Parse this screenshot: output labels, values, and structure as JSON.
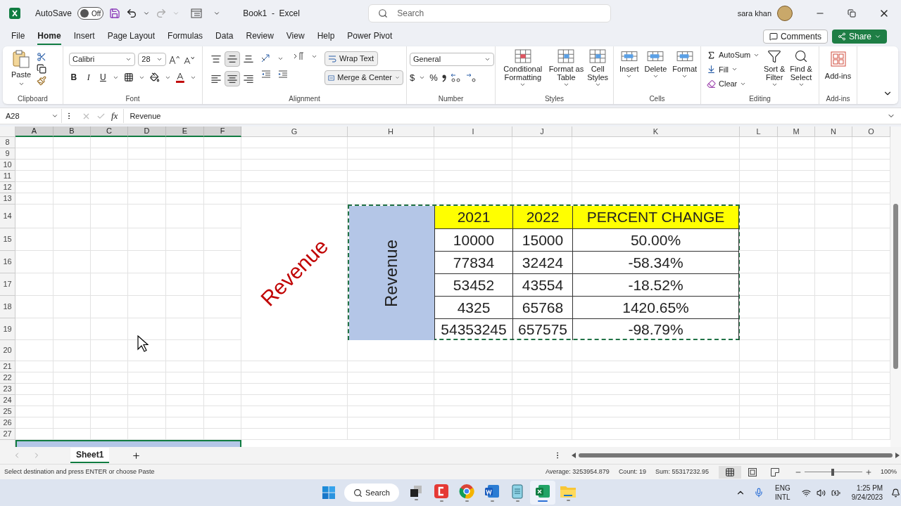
{
  "title_bar": {
    "autosave_label": "AutoSave",
    "autosave_state": "Off",
    "autosave_on": false,
    "document_title": "Book1  -  Excel",
    "search_placeholder": "Search",
    "user_name": "sara khan"
  },
  "ribbon_tabs": [
    {
      "label": "File",
      "selected": false
    },
    {
      "label": "Home",
      "selected": true
    },
    {
      "label": "Insert",
      "selected": false
    },
    {
      "label": "Page Layout",
      "selected": false
    },
    {
      "label": "Formulas",
      "selected": false
    },
    {
      "label": "Data",
      "selected": false
    },
    {
      "label": "Review",
      "selected": false
    },
    {
      "label": "View",
      "selected": false
    },
    {
      "label": "Help",
      "selected": false
    },
    {
      "label": "Power Pivot",
      "selected": false
    }
  ],
  "comments_button": "Comments",
  "share_button": "Share",
  "ribbon": {
    "clipboard": {
      "paste": "Paste",
      "label": "Clipboard"
    },
    "font": {
      "name": "Calibri",
      "size": "28",
      "bold": "B",
      "italic": "I",
      "underline": "U",
      "label": "Font"
    },
    "alignment": {
      "buttons": [
        {
          "kind": "top",
          "selected": false
        },
        {
          "kind": "middle",
          "selected": true
        },
        {
          "kind": "bottom",
          "selected": false
        },
        {
          "kind": "left",
          "selected": false
        },
        {
          "kind": "center",
          "selected": true
        },
        {
          "kind": "right",
          "selected": false
        }
      ],
      "wrap_text": "Wrap Text",
      "merge_center": "Merge & Center",
      "label": "Alignment"
    },
    "number": {
      "format": "General",
      "currency": "$",
      "percent": "%",
      "label": "Number"
    },
    "styles": {
      "items": [
        "Conditional Formatting",
        "Format as Table",
        "Cell Styles"
      ],
      "label": "Styles"
    },
    "cells": {
      "items": [
        "Insert",
        "Delete",
        "Format"
      ],
      "label": "Cells"
    },
    "editing": {
      "autosum": "AutoSum",
      "fill": "Fill",
      "clear": "Clear",
      "sort_filter": "Sort & Filter",
      "find_select": "Find & Select",
      "label": "Editing"
    },
    "addins": {
      "button": "Add-ins",
      "label": "Add-ins"
    }
  },
  "formula_bar": {
    "name_box": "A28",
    "function_symbol": "fx",
    "formula": "Revenue"
  },
  "columns": [
    {
      "label": "A",
      "selected": true
    },
    {
      "label": "B",
      "selected": true
    },
    {
      "label": "C",
      "selected": true
    },
    {
      "label": "D",
      "selected": true
    },
    {
      "label": "E",
      "selected": true
    },
    {
      "label": "F",
      "selected": true
    },
    {
      "label": "G",
      "selected": false
    },
    {
      "label": "H",
      "selected": false
    },
    {
      "label": "I",
      "selected": false
    },
    {
      "label": "J",
      "selected": false
    },
    {
      "label": "K",
      "selected": false
    },
    {
      "label": "L",
      "selected": false
    },
    {
      "label": "M",
      "selected": false
    },
    {
      "label": "N",
      "selected": false
    },
    {
      "label": "O",
      "selected": false
    }
  ],
  "rows": [
    "8",
    "9",
    "10",
    "11",
    "12",
    "13",
    "14",
    "15",
    "16",
    "17",
    "18",
    "19",
    "20",
    "21",
    "22",
    "23",
    "24",
    "25",
    "26",
    "27"
  ],
  "rotated_label": "Revenue",
  "table": {
    "side_label": "Revenue",
    "header": [
      "2021",
      "2022",
      "PERCENT CHANGE"
    ],
    "rows": [
      [
        "10000",
        "15000",
        "50.00%"
      ],
      [
        "77834",
        "32424",
        "-58.34%"
      ],
      [
        "53452",
        "43554",
        "-18.52%"
      ],
      [
        "4325",
        "65768",
        "1420.65%"
      ],
      [
        "54353245",
        "657575",
        "-98.79%"
      ]
    ]
  },
  "sheet_tabs": [
    {
      "label": "Sheet1",
      "selected": true
    }
  ],
  "status_bar": {
    "message": "Select destination and press ENTER or choose Paste",
    "average": "Average: 3253954.879",
    "count": "Count: 19",
    "sum": "Sum: 55317232.95",
    "views": [
      {
        "kind": "normal",
        "selected": true
      },
      {
        "kind": "page_layout",
        "selected": false
      },
      {
        "kind": "page_break",
        "selected": false
      }
    ],
    "zoom": {
      "level": 0.49,
      "reading": "100%"
    }
  },
  "taskbar": {
    "search": "Search",
    "apps": [
      {
        "kind": "taskview",
        "selected": false
      },
      {
        "kind": "red",
        "selected": false
      },
      {
        "kind": "chrome",
        "selected": false
      },
      {
        "kind": "word",
        "selected": false
      },
      {
        "kind": "notepad",
        "selected": false
      },
      {
        "kind": "excel",
        "selected": true
      },
      {
        "kind": "folder",
        "selected": false
      }
    ],
    "language": "ENG",
    "layout": "INTL",
    "time": "1:25 PM",
    "date": "9/24/2023"
  }
}
